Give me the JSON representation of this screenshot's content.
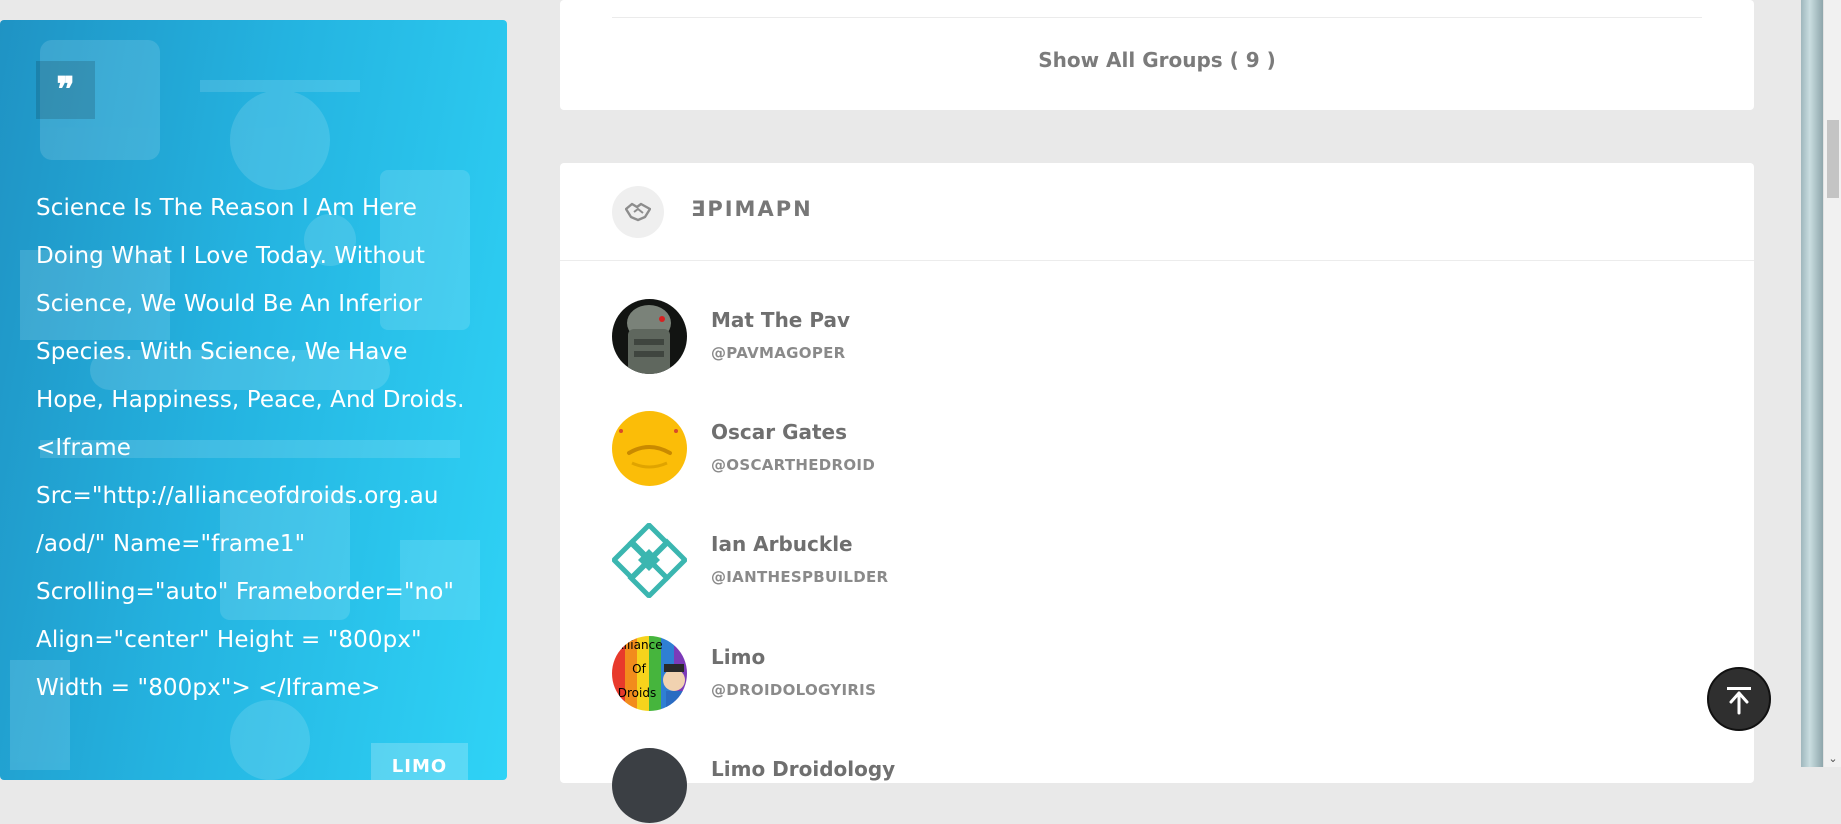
{
  "quote": {
    "icon": "quote-icon",
    "text": "Science Is The Reason I Am Here Doing What I Love Today. Without Science, We Would Be An Inferior Species. With Science, We Have Hope, Happiness, Peace, And Droids. <Iframe Src=\"http://allianceofdroids.org.au /aod/\" Name=\"frame1\" Scrolling=\"auto\" Frameborder=\"no\" Align=\"center\" Height = \"800px\" Width = \"800px\"> </Iframe>",
    "author": "LIMO",
    "gradient_start": "#1f93c4",
    "gradient_end": "#2fd3f6"
  },
  "groups": {
    "show_all_label": "Show All Groups ( 9 )"
  },
  "friends": {
    "icon": "handshake-icon",
    "title": "ƎPIMAPN",
    "items": [
      {
        "name": "Mat The Pav",
        "handle": "@PAVMAGOPER"
      },
      {
        "name": "Oscar Gates",
        "handle": "@OSCARTHEDROID"
      },
      {
        "name": "Ian Arbuckle",
        "handle": "@IANTHESPBUILDER"
      },
      {
        "name": "Limo",
        "handle": "@DROIDOLOGYIRIS",
        "avatar_text": [
          "Alliance",
          "Of",
          "Droids"
        ]
      },
      {
        "name": "Limo Droidology",
        "handle": ""
      }
    ]
  },
  "back_to_top": {
    "icon": "arrow-up-icon"
  },
  "colors": {
    "page_bg": "#e9e9e9",
    "panel_bg": "#ffffff",
    "text_muted": "#6f6f6f",
    "back_to_top_bg": "#2f2f2f"
  }
}
